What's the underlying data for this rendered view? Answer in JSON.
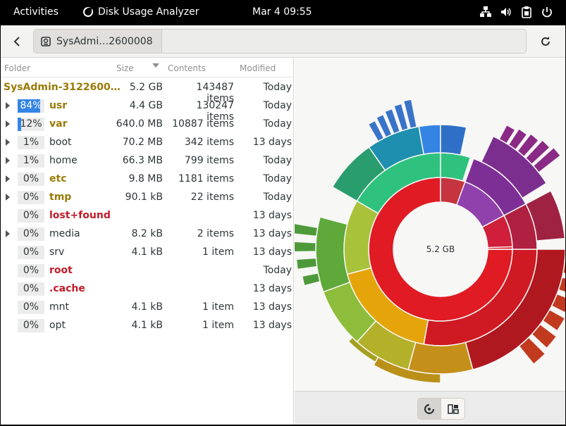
{
  "topbar": {
    "activities": "Activities",
    "app_name": "Disk Usage Analyzer",
    "clock": "Mar 4  09:55",
    "tray_icons": [
      "network-icon",
      "volume-icon",
      "clipboard-icon",
      "power-icon"
    ]
  },
  "headerbar": {
    "path_label": "SysAdmi…2600008",
    "icons": [
      "back-arrow-icon",
      "drive-icon",
      "reload-icon"
    ]
  },
  "tree": {
    "headers": {
      "folder": "Folder",
      "size": "Size",
      "contents": "Contents",
      "modified": "Modified"
    },
    "root": {
      "name": "SysAdmin-3122600…",
      "size": "5.2 GB",
      "contents": "143487 items",
      "modified": "Today"
    },
    "rows": [
      {
        "pct": "84%",
        "name": "usr",
        "size": "4.4 GB",
        "contents": "130247 items",
        "modified": "Today",
        "style": "gold",
        "fill": 0.84,
        "expandable": true
      },
      {
        "pct": "12%",
        "name": "var",
        "size": "640.0 MB",
        "contents": "10887 items",
        "modified": "Today",
        "style": "gold",
        "fill": 0.12,
        "expandable": true
      },
      {
        "pct": "1%",
        "name": "boot",
        "size": "70.2 MB",
        "contents": "342 items",
        "modified": "13 days",
        "style": "normal",
        "fill": 0,
        "expandable": true
      },
      {
        "pct": "1%",
        "name": "home",
        "size": "66.3 MB",
        "contents": "799 items",
        "modified": "Today",
        "style": "normal",
        "fill": 0,
        "expandable": true
      },
      {
        "pct": "0%",
        "name": "etc",
        "size": "9.8 MB",
        "contents": "1181 items",
        "modified": "Today",
        "style": "gold",
        "fill": 0,
        "expandable": true
      },
      {
        "pct": "0%",
        "name": "tmp",
        "size": "90.1 kB",
        "contents": "22 items",
        "modified": "Today",
        "style": "gold",
        "fill": 0,
        "expandable": true
      },
      {
        "pct": "0%",
        "name": "lost+found",
        "size": "",
        "contents": "",
        "modified": "13 days",
        "style": "red",
        "fill": 0,
        "expandable": false
      },
      {
        "pct": "0%",
        "name": "media",
        "size": "8.2 kB",
        "contents": "2 items",
        "modified": "13 days",
        "style": "normal",
        "fill": 0,
        "expandable": true
      },
      {
        "pct": "0%",
        "name": "srv",
        "size": "4.1 kB",
        "contents": "1 item",
        "modified": "13 days",
        "style": "normal",
        "fill": 0,
        "expandable": false
      },
      {
        "pct": "0%",
        "name": "root",
        "size": "",
        "contents": "",
        "modified": "Today",
        "style": "red",
        "fill": 0,
        "expandable": false
      },
      {
        "pct": "0%",
        "name": ".cache",
        "size": "",
        "contents": "",
        "modified": "13 days",
        "style": "red",
        "fill": 0,
        "expandable": false
      },
      {
        "pct": "0%",
        "name": "mnt",
        "size": "4.1 kB",
        "contents": "1 item",
        "modified": "13 days",
        "style": "normal",
        "fill": 0,
        "expandable": false
      },
      {
        "pct": "0%",
        "name": "opt",
        "size": "4.1 kB",
        "contents": "1 item",
        "modified": "13 days",
        "style": "normal",
        "fill": 0,
        "expandable": false
      }
    ]
  },
  "chart": {
    "center_label": "5.2 GB",
    "view_buttons": [
      "ring-chart-icon",
      "treemap-icon"
    ],
    "colors": {
      "red": "#e01b24",
      "green": "#2ec27e",
      "purple": "#9141ac",
      "blue": "#3584e4",
      "olive": "#b5b000",
      "orange": "#e5a50a",
      "gold": "#9a7a07",
      "selection": "#3584e4"
    }
  }
}
